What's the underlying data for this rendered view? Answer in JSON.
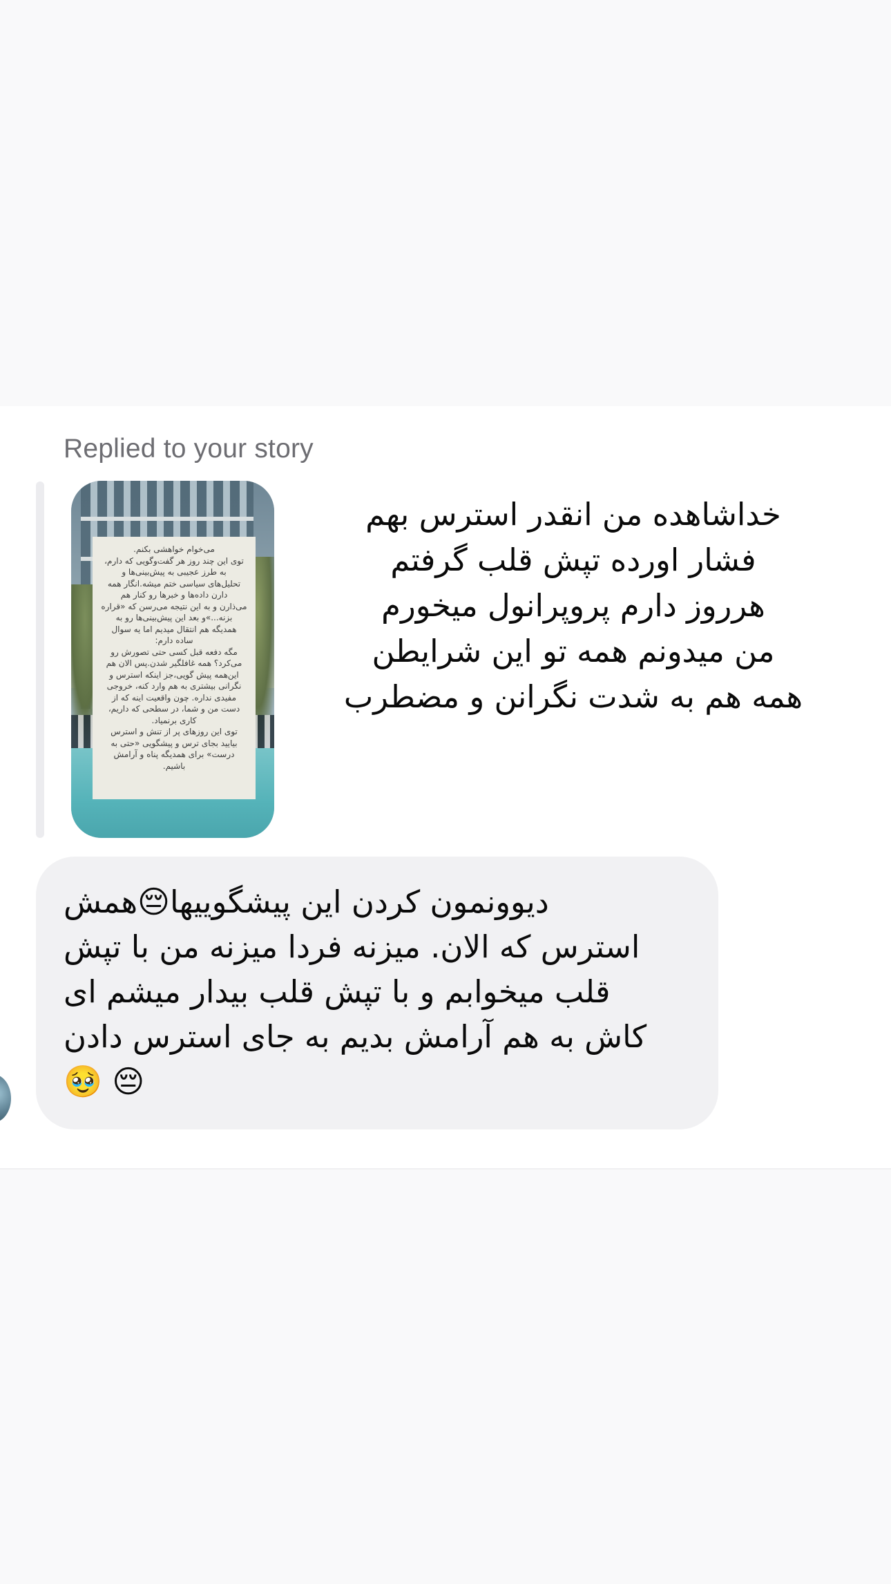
{
  "thread": {
    "reply_label": "Replied to your story",
    "story": {
      "card_text": "می‌خوام خواهشی بکنم.\nتوی این چند روز هر گفت‌وگویی که دارم،\nبه طرز عجیبی به پیش‌بینی‌ها و\nتحلیل‌های سیاسی ختم میشه.انگار همه\nدارن داده‌ها و خبرها رو کنار هم\nمی‌ذارن و به این نتیجه می‌رسن که «قراره\nبزنه...»و بعد این پیش‌بینی‌ها رو به\nهمدیگه هم انتقال میدیم اما یه سوال\nساده دارم:\nمگه دفعه قبل کسی حتی تصورش رو\nمی‌کرد؟ همه غافلگیر شدن.پس الان هم\nاین‌همه پیش گویی،جز اینکه استرس و\nنگرانی بیشتری به هم وارد کنه، خروجی\nمفیدی نداره. چون واقعیت اینه که از\nدست من و شما، در سطحی که داریم،\nکاری برنمیاد.\nتوی این روزهای پر از تنش و استرس\nبیایید بجای ترس و پیشگویی «حتی به\nدرست» برای همدیگه پناه و آرامش\nباشیم."
    },
    "story_reply_text": "خداشاهده من انقدر استرس بهم\nفشار اورده تپش قلب گرفتم\nهرروز دارم پروپرانول میخورم\nمن میدونم همه تو این شرایطن\nهمه هم به شدت نگرانن و مضطرب",
    "message_text": "دیوونمون کردن این پیشگوییها😔همش\nاسترس که الان. میزنه فردا میزنه من با تپش\nقلب میخوابم و با تپش قلب بیدار میشم ای\nکاش به هم آرامش بدیم به جای استرس دادن\n😔 🥹"
  }
}
